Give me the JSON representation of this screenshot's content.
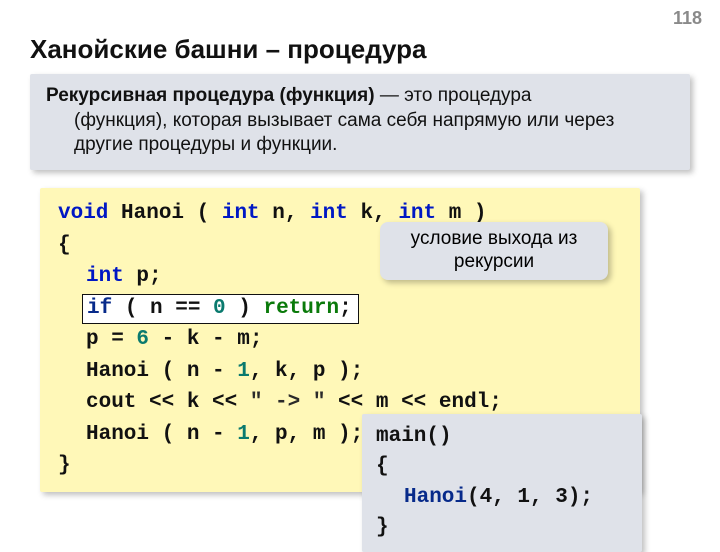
{
  "page_number": "118",
  "title": "Ханойские башни – процедура",
  "definition": {
    "term": "Рекурсивная процедура (функция)",
    "rest1": " — это процедура",
    "rest2": "(функция), которая вызывает сама себя напрямую или через другие процедуры и функции."
  },
  "code": {
    "l1_void": "void",
    "l1_name": " Hanoi ( ",
    "l1_int": "int",
    "l1_n": " n, ",
    "l1_k": " k, ",
    "l1_m": " m )",
    "l2": "{",
    "l3_int": "int",
    "l3_p": " p;",
    "l4_if": "if",
    "l4_cond": " ( n == ",
    "l4_zero": "0",
    "l4_close": " ) ",
    "l4_return": "return",
    "l4_semi": ";",
    "l5a": "p = ",
    "l5_six": "6",
    "l5b": " - k - m;",
    "l6a": "Hanoi ( n - ",
    "l6_one": "1",
    "l6b": ", k, p );",
    "l7a": "cout << k << ",
    "l7_str": "\" -> \"",
    "l7b": " << m << endl;",
    "l8a": "Hanoi ( n - ",
    "l8_one": "1",
    "l8b": ", p, m );",
    "l9": "}"
  },
  "callout1_line1": "условие выхода из",
  "callout1_line2": "рекурсии",
  "mainbox": {
    "l1": "main()",
    "l2": "{",
    "l3a": "Hanoi",
    "l3b": "(4, 1, 3);",
    "l4": "}"
  }
}
